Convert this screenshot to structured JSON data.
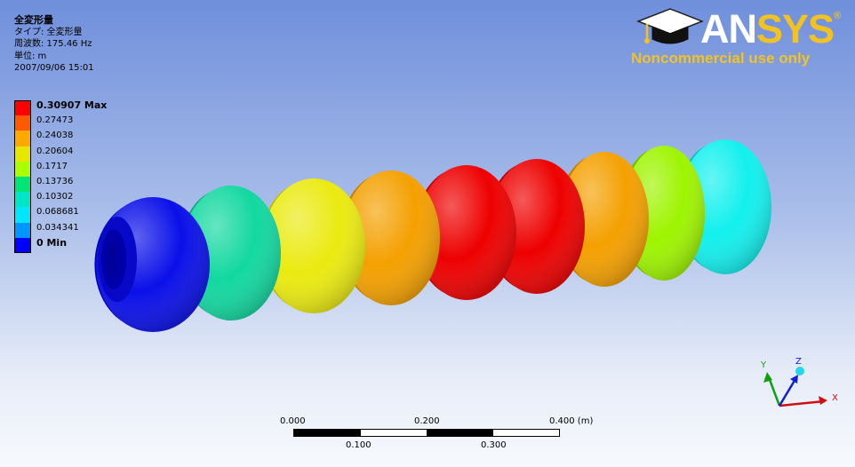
{
  "result": {
    "title": "全変形量",
    "type_line": "タイプ: 全変形量",
    "frequency_line": "周波数: 175.46 Hz",
    "unit_line": "単位: m",
    "date_line": "2007/09/06 15:01"
  },
  "legend": [
    {
      "label": "0.30907 Max",
      "color": "#ff0000",
      "bold": true
    },
    {
      "label": "0.27473",
      "color": "#ff5a00",
      "bold": false
    },
    {
      "label": "0.24038",
      "color": "#ffa800",
      "bold": false
    },
    {
      "label": "0.20604",
      "color": "#e6e600",
      "bold": false
    },
    {
      "label": "0.1717",
      "color": "#aaff00",
      "bold": false
    },
    {
      "label": "0.13736",
      "color": "#00e676",
      "bold": false
    },
    {
      "label": "0.10302",
      "color": "#00e6c3",
      "bold": false
    },
    {
      "label": "0.068681",
      "color": "#00e6ff",
      "bold": false
    },
    {
      "label": "0.034341",
      "color": "#0096ff",
      "bold": false
    },
    {
      "label": "0 Min",
      "color": "#0000ff",
      "bold": true
    }
  ],
  "logo": {
    "word_an": "AN",
    "word_sys": "SYS",
    "registered": "®",
    "subtitle": "Noncommercial use only",
    "colors": {
      "white": "#ffffff",
      "gold": "#f2c320"
    }
  },
  "scale": {
    "top_labels": [
      "0.000",
      "0.200",
      "0.400 (m)"
    ],
    "bottom_labels": [
      "0.100",
      "0.300"
    ]
  },
  "triad": {
    "x": "X",
    "y": "Y",
    "z": "Z"
  },
  "model": {
    "cells": [
      {
        "fill": "#0a10e8",
        "rim": "#0000b8"
      },
      {
        "fill": "#12d8a0",
        "rim": "#0ea67a"
      },
      {
        "fill": "#eaea10",
        "rim": "#bcbc00"
      },
      {
        "fill": "#f4a000",
        "rim": "#c47e00"
      },
      {
        "fill": "#ee0000",
        "rim": "#b80000"
      },
      {
        "fill": "#ee0000",
        "rim": "#b80000"
      },
      {
        "fill": "#f4a000",
        "rim": "#c47e00"
      },
      {
        "fill": "#9ef400",
        "rim": "#76c000"
      },
      {
        "fill": "#12f0ee",
        "rim": "#0ebebe"
      }
    ]
  }
}
